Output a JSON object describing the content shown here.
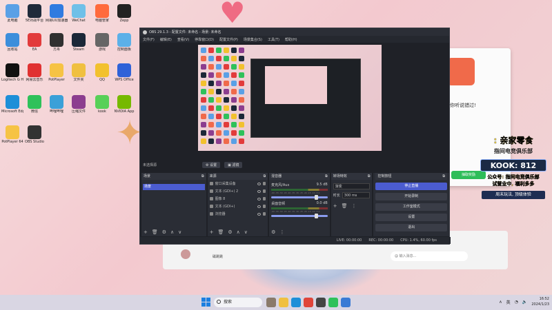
{
  "desktop": {
    "icons": [
      {
        "label": "此电脑",
        "color": "#5aa0e6"
      },
      {
        "label": "5E对战平台",
        "color": "#1f2a3a"
      },
      {
        "label": "网易UU加速器",
        "color": "#2f7be0"
      },
      {
        "label": "WeChat",
        "color": "#6fc0e8"
      },
      {
        "label": "电脑管家",
        "color": "#ff6a3c"
      },
      {
        "label": "Zepp",
        "color": "#222"
      },
      {
        "label": "回收站",
        "color": "#3c8edb"
      },
      {
        "label": "EA",
        "color": "#e23b3b"
      },
      {
        "label": "方舟",
        "color": "#303030"
      },
      {
        "label": "Steam",
        "color": "#1b2838"
      },
      {
        "label": "游戏",
        "color": "#666"
      },
      {
        "label": "控制面板",
        "color": "#5cb0e8"
      },
      {
        "label": "Logitech G HUB",
        "color": "#111"
      },
      {
        "label": "网易云音乐",
        "color": "#e03131"
      },
      {
        "label": "PotPlayer",
        "color": "#f6c344"
      },
      {
        "label": "文件夹",
        "color": "#f0c040"
      },
      {
        "label": "QQ",
        "color": "#f2c12e"
      },
      {
        "label": "WPS Office",
        "color": "#2f62d8"
      },
      {
        "label": "Microsoft Edge",
        "color": "#1d8fd8"
      },
      {
        "label": "微信",
        "color": "#2fc15a"
      },
      {
        "label": "哔哩哔哩",
        "color": "#3aa0d8"
      },
      {
        "label": "压缩文件",
        "color": "#8c3d8f"
      },
      {
        "label": "kook",
        "color": "#58d058"
      },
      {
        "label": "NVIDIA App",
        "color": "#76b900"
      },
      {
        "label": "PotPlayer 64",
        "color": "#f6c344"
      },
      {
        "label": "OBS Studio",
        "color": "#333"
      }
    ]
  },
  "obs": {
    "title": "OBS 29.1.3 - 配置文件: 未命名 - 场景: 未命名",
    "menu": [
      "文件(F)",
      "编辑(E)",
      "查看(V)",
      "停靠窗口(D)",
      "配置文件(P)",
      "场景集合(S)",
      "工具(T)",
      "帮助(H)"
    ],
    "scene_info": {
      "label": "未选择源",
      "properties": "⚙ 设置",
      "filters": "▣ 滤镜"
    },
    "docks": {
      "scenes": {
        "title": "场景",
        "items": [
          "场景"
        ]
      },
      "sources": {
        "title": "来源",
        "items": [
          "窗口采集设备",
          "文本 (GDI+) 2",
          "图像 8",
          "文本 (GDI+)",
          "浏览器"
        ]
      },
      "mixer": {
        "title": "混音器",
        "channels": [
          {
            "name": "麦克风/Aux",
            "db": "9.5 dB"
          },
          {
            "name": "桌面音频",
            "db": "0.0 dB"
          }
        ],
        "ticks": "-60 -55 -50 -45 -40 -35 -30 -25 -20 -15 -10 -5 0"
      },
      "transitions": {
        "title": "转场特效",
        "type": "渐变",
        "duration_label": "时长",
        "duration": "300 ms"
      },
      "controls": {
        "title": "控制按钮",
        "buttons": [
          "停止直播",
          "开始录制",
          "工作室模式",
          "设置",
          "退出"
        ]
      }
    },
    "status": {
      "live": "LIVE: 00:00:00",
      "rec": "REC: 00:00:00",
      "cpu": "CPU: 1.4%, 60.00 fps"
    }
  },
  "popup": {
    "title": "你听说错过!",
    "button": "抽取奖励"
  },
  "promo": {
    "line1": ": 亲家零食",
    "line2": "指间电竞俱乐部",
    "kook": "KOOK: 812",
    "line3": "公众号: 指间电竞俱乐部",
    "line4": "试营业中, 福利多多",
    "line5": "周末玩法, 顶级体验"
  },
  "chat": {
    "contact": "磁跳跳",
    "input_placeholder": "@ 输入消息..."
  },
  "taskbar": {
    "search_placeholder": "搜索",
    "ime": "英",
    "time": "16:52",
    "date": "2024/1/23"
  }
}
